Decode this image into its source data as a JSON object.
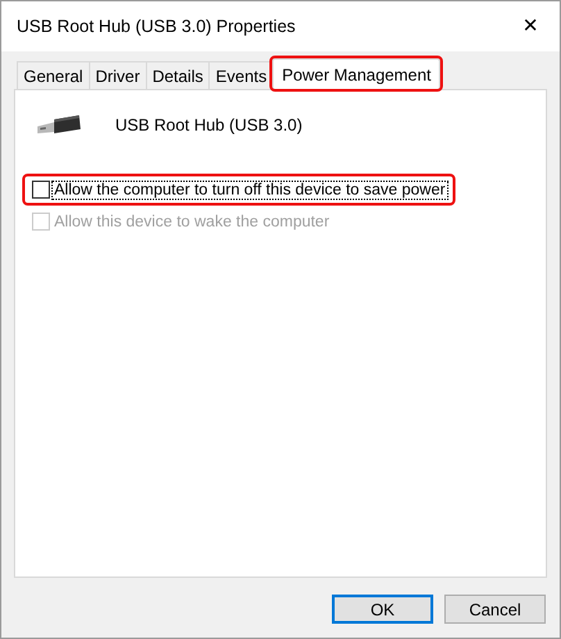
{
  "window": {
    "title": "USB Root Hub (USB 3.0) Properties",
    "close": "✕"
  },
  "tabs": [
    {
      "label": "General",
      "selected": false,
      "highlighted": false
    },
    {
      "label": "Driver",
      "selected": false,
      "highlighted": false
    },
    {
      "label": "Details",
      "selected": false,
      "highlighted": false
    },
    {
      "label": "Events",
      "selected": false,
      "highlighted": false
    },
    {
      "label": "Power Management",
      "selected": true,
      "highlighted": true
    }
  ],
  "device": {
    "name": "USB Root Hub (USB 3.0)"
  },
  "options": [
    {
      "label": "Allow the computer to turn off this device to save power",
      "checked": false,
      "disabled": false,
      "focused": true,
      "highlighted": true
    },
    {
      "label": "Allow this device to wake the computer",
      "checked": false,
      "disabled": true,
      "focused": false,
      "highlighted": false
    }
  ],
  "buttons": [
    {
      "label": "OK",
      "default": true
    },
    {
      "label": "Cancel",
      "default": false
    }
  ]
}
